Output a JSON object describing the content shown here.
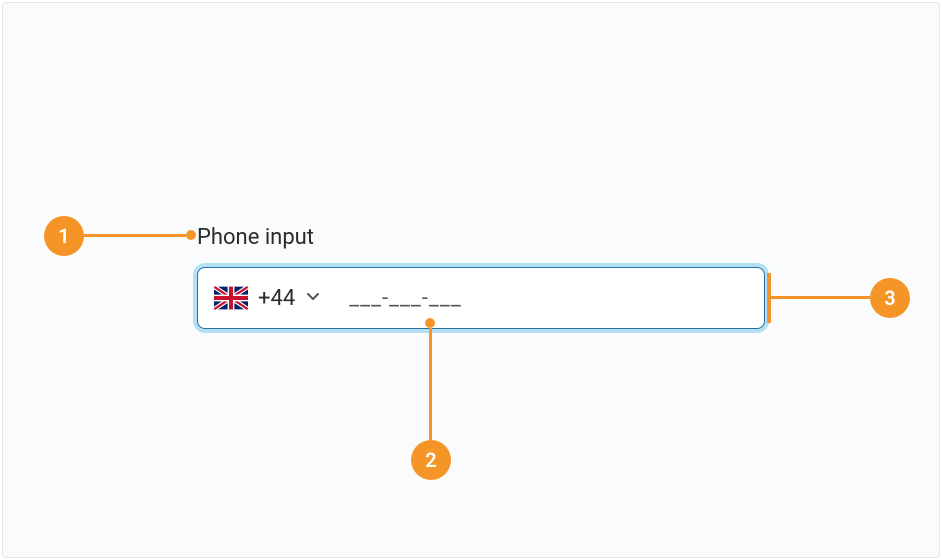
{
  "label": "Phone input",
  "country": {
    "dial_code": "+44",
    "flag": "uk"
  },
  "input": {
    "mask_placeholder": "___-___-___"
  },
  "annotations": {
    "one": "1",
    "two": "2",
    "three": "3"
  }
}
